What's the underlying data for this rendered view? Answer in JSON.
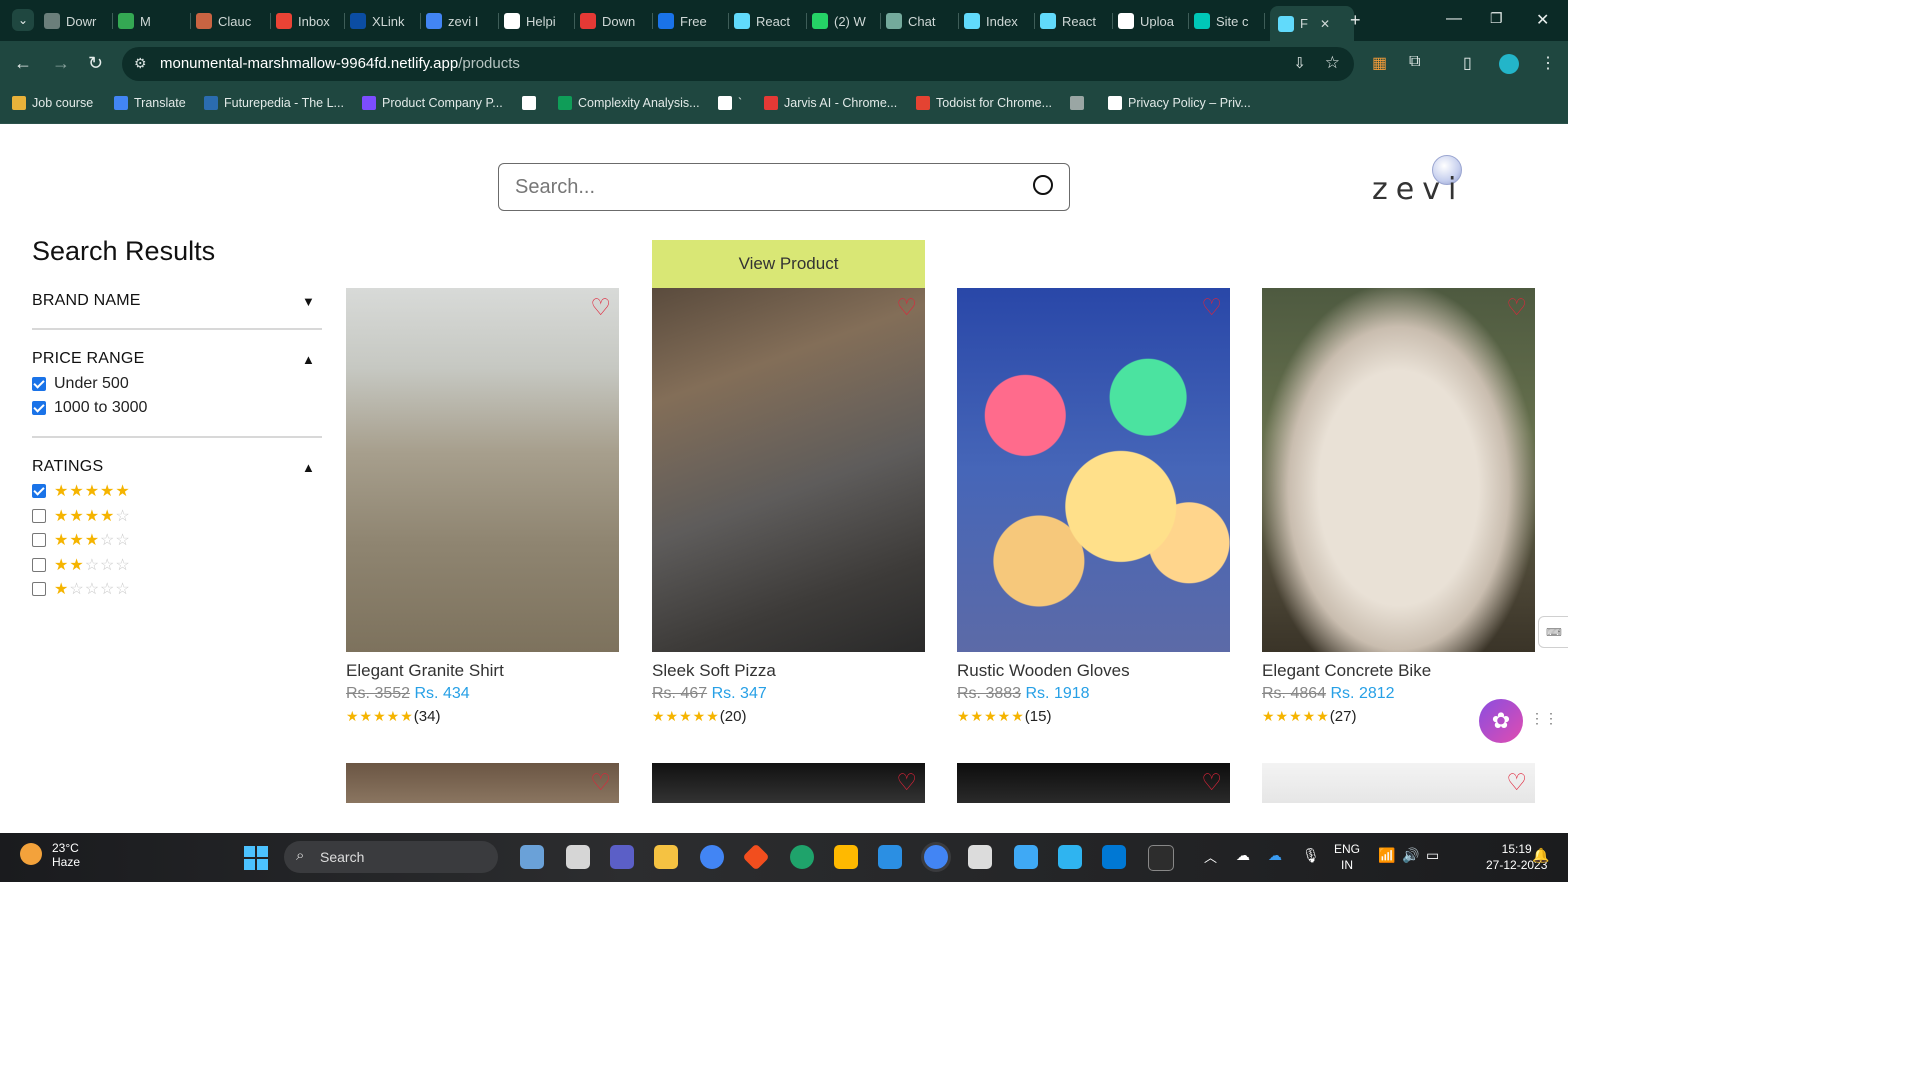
{
  "browser": {
    "tabs": [
      {
        "label": "Dowr",
        "color": "#6b7f7b"
      },
      {
        "label": "M",
        "color": "#34a853"
      },
      {
        "label": "Clauc",
        "color": "#c96442"
      },
      {
        "label": "Inbox",
        "color": "#ea4335"
      },
      {
        "label": "XLink",
        "color": "#0b4da3"
      },
      {
        "label": "zevi I",
        "color": "#4285f4"
      },
      {
        "label": "Helpi",
        "color": "#ffffff"
      },
      {
        "label": "Down",
        "color": "#e53935"
      },
      {
        "label": "Free",
        "color": "#1a73e8"
      },
      {
        "label": "React",
        "color": "#61dafb"
      },
      {
        "label": "(2) W",
        "color": "#25d366"
      },
      {
        "label": "Chat",
        "color": "#74aa9c"
      },
      {
        "label": "Index",
        "color": "#61dafb"
      },
      {
        "label": "React",
        "color": "#61dafb"
      },
      {
        "label": "Uploa",
        "color": "#ffffff"
      },
      {
        "label": "Site c",
        "color": "#00c7b7"
      },
      {
        "label": "F",
        "color": "#61dafb"
      }
    ],
    "url_host": "monumental-marshmallow-9964fd.netlify.app",
    "url_path": "/products",
    "bookmarks": [
      {
        "label": "Job course",
        "color": "#e8b23a"
      },
      {
        "label": "Translate",
        "color": "#4285f4"
      },
      {
        "label": "Futurepedia - The L...",
        "color": "#2b6cb0"
      },
      {
        "label": "Product Company P...",
        "color": "#7c4dff"
      },
      {
        "label": "",
        "color": "#ffffff"
      },
      {
        "label": "Complexity Analysis...",
        "color": "#0f9d58"
      },
      {
        "label": "`",
        "color": "#ffffff"
      },
      {
        "label": "Jarvis AI - Chrome...",
        "color": "#e53935"
      },
      {
        "label": "Todoist for Chrome...",
        "color": "#e44332"
      },
      {
        "label": "",
        "color": "#9aa6a4"
      },
      {
        "label": "Privacy Policy – Priv...",
        "color": "#ffffff"
      }
    ]
  },
  "search": {
    "placeholder": "Search..."
  },
  "logo": {
    "text": "zevi"
  },
  "sidebar": {
    "title": "Search Results",
    "brand": {
      "label": "BRAND NAME"
    },
    "price": {
      "label": "PRICE RANGE",
      "options": [
        {
          "label": "Under 500",
          "checked": true
        },
        {
          "label": "1000 to 3000",
          "checked": true
        }
      ]
    },
    "ratings": {
      "label": "RATINGS",
      "options": [
        {
          "stars": 5,
          "checked": true
        },
        {
          "stars": 4,
          "checked": false
        },
        {
          "stars": 3,
          "checked": false
        },
        {
          "stars": 2,
          "checked": false
        },
        {
          "stars": 1,
          "checked": false
        }
      ]
    }
  },
  "products": [
    {
      "name": "Elegant Granite Shirt",
      "old_price": "Rs. 3552",
      "new_price": "Rs. 434",
      "rating_count": "(34)",
      "stars": 5
    },
    {
      "name": "Sleek Soft Pizza",
      "old_price": "Rs. 467",
      "new_price": "Rs. 347",
      "rating_count": "(20)",
      "stars": 5,
      "overlay": "View Product"
    },
    {
      "name": "Rustic Wooden Gloves",
      "old_price": "Rs. 3883",
      "new_price": "Rs. 1918",
      "rating_count": "(15)",
      "stars": 5
    },
    {
      "name": "Elegant Concrete Bike",
      "old_price": "Rs. 4864",
      "new_price": "Rs. 2812",
      "rating_count": "(27)",
      "stars": 5
    }
  ],
  "taskbar": {
    "weather_temp": "23°C",
    "weather_desc": "Haze",
    "search_label": "Search",
    "lang_top": "ENG",
    "lang_bottom": "IN",
    "time": "15:19",
    "date": "27-12-2023"
  }
}
